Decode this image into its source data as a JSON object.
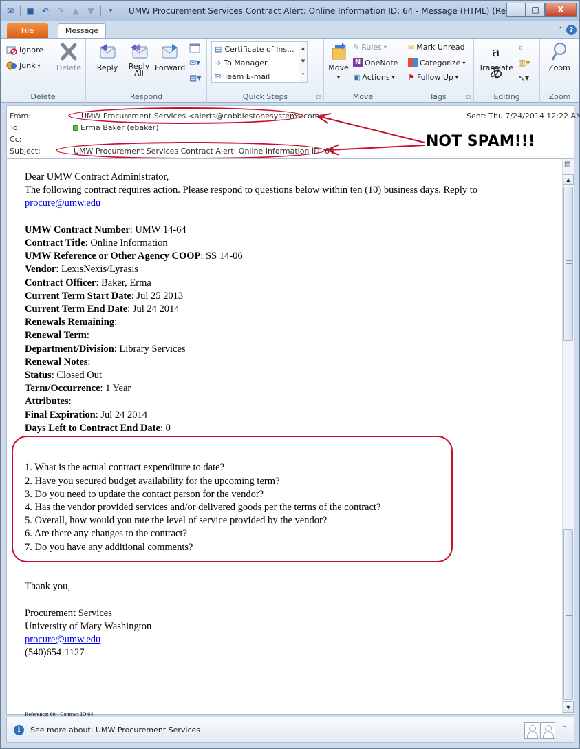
{
  "window": {
    "title": "UMW Procurement Services Contract Alert: Online Information ID: 64  -  Message (HTML) (Read-O...",
    "minimize": "–",
    "maximize": "□",
    "close": "X"
  },
  "tabs": {
    "file": "File",
    "message": "Message"
  },
  "ribbon": {
    "delete_group": {
      "label": "Delete",
      "ignore": "Ignore",
      "junk": "Junk",
      "delete": "Delete"
    },
    "respond_group": {
      "label": "Respond",
      "reply": "Reply",
      "reply_all_line1": "Reply",
      "reply_all_line2": "All",
      "forward": "Forward"
    },
    "quicksteps_group": {
      "label": "Quick Steps",
      "items": [
        "Certificate of Ins...",
        "To Manager",
        "Team E-mail"
      ]
    },
    "move_group": {
      "label": "Move",
      "move": "Move",
      "rules": "Rules",
      "onenote": "OneNote",
      "actions": "Actions"
    },
    "tags_group": {
      "label": "Tags",
      "mark_unread": "Mark Unread",
      "categorize": "Categorize",
      "follow_up": "Follow Up"
    },
    "editing_group": {
      "label": "Editing",
      "translate": "Translate"
    },
    "zoom_group": {
      "label": "Zoom",
      "zoom": "Zoom"
    }
  },
  "header": {
    "from_label": "From:",
    "from_value": "UMW Procurement Services  <alerts@cobblestonesystems.com>",
    "to_label": "To:",
    "to_value": "Erma Baker (ebaker)",
    "cc_label": "Cc:",
    "subject_label": "Subject:",
    "subject_value": "UMW Procurement Services Contract Alert: Online Information ID: 64",
    "sent_label": "Sent:",
    "sent_value": "Thu 7/24/2014 12:22 AM"
  },
  "annotation": {
    "text": "NOT SPAM!!!",
    "color": "#c8102e"
  },
  "body": {
    "greeting": "Dear UMW Contract Administrator,",
    "intro": "The following contract requires action. Please respond to questions below within ten (10) business days. Reply to",
    "reply_email": "procure@umw.edu",
    "fields": [
      {
        "label": "UMW Contract Number",
        "value": ": UMW 14-64"
      },
      {
        "label": "Contract Title",
        "value": ": Online Information"
      },
      {
        "label": "UMW Reference or Other Agency COOP",
        "value": ": SS 14-06"
      },
      {
        "label": "Vendor",
        "value": ": LexisNexis/Lyrasis"
      },
      {
        "label": "Contract Officer",
        "value": ": Baker, Erma"
      },
      {
        "label": "Current Term Start Date",
        "value": ": Jul 25 2013"
      },
      {
        "label": "Current Term End Date",
        "value": ": Jul 24 2014"
      },
      {
        "label": "Renewals Remaining",
        "value": ":"
      },
      {
        "label": "Renewal Term",
        "value": ":"
      },
      {
        "label": "Department/Division",
        "value": ": Library Services"
      },
      {
        "label": "Renewal Notes",
        "value": ":"
      },
      {
        "label": "Status",
        "value": ": Closed Out"
      },
      {
        "label": "Term/Occurrence",
        "value": ": 1 Year"
      },
      {
        "label": "Attributes",
        "value": ":"
      },
      {
        "label": "Final Expiration",
        "value": ": Jul 24 2014"
      },
      {
        "label": "Days Left to Contract End Date",
        "value": ": 0"
      }
    ],
    "questions": [
      "1. What is the actual contract expenditure to date?",
      "2. Have you secured budget availability for the upcoming term?",
      "3. Do you need to update the contact person for the vendor?",
      "4. Has the vendor provided services and/or delivered goods per the terms of the contract?",
      "5. Overall, how would you rate the level of service provided by the vendor?",
      "6. Are there any changes to the contract?",
      "7. Do you have any additional comments?"
    ],
    "closing": "Thank you,",
    "signature": [
      "Procurement Services",
      "University of Mary Washington"
    ],
    "signature_email": "procure@umw.edu",
    "signature_phone": "(540)654-1127",
    "reference": "Reference: 69 - Contract ID 64"
  },
  "people_pane": {
    "text": "See more about: UMW Procurement Services ."
  }
}
